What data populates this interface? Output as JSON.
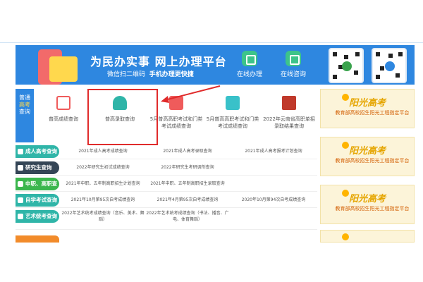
{
  "banner": {
    "title": "为民办实事  网上办理平台",
    "sub_prefix": "微信扫二维码",
    "sub_bold": "手机办理更快捷",
    "services": [
      {
        "label": "在线办理",
        "icon": "edit-icon"
      },
      {
        "label": "在线咨询",
        "icon": "chat-icon"
      }
    ],
    "qr_codes": [
      "qr-code-1",
      "qr-code-2"
    ]
  },
  "category": {
    "line1": "普通",
    "line2": "高考",
    "line3": "查询"
  },
  "tiles": [
    {
      "label": "普高成绩查询",
      "icon": "search-doc-icon",
      "color": "#ef5b5b"
    },
    {
      "label": "普高录取查询",
      "icon": "graduation-cap-icon",
      "color": "#2fb5a8"
    },
    {
      "label": "5月普高高职考试和门类考试成绩查询",
      "icon": "letter-a-icon",
      "color": "#ef5b5b"
    },
    {
      "label": "5月普高高职考试和门类考试成绩查询",
      "icon": "letter-a-icon",
      "color": "#39c1c9"
    },
    {
      "label": "2022年云南省高职单招录取结果查询",
      "icon": "building-icon",
      "color": "#c0392b"
    }
  ],
  "promo": {
    "title": "阳光高考",
    "subtitle": "教育部高校招生阳光工程指定平台",
    "count": 4
  },
  "rows": [
    {
      "label": "成人高考查询",
      "color": "#2fb5a8",
      "cells": [
        "2021年成人高考成绩查询",
        "2021年成人高考录取查询",
        "2021年成人高考报考计划查询"
      ]
    },
    {
      "label": "研究生查询",
      "color": "#344556",
      "cells": [
        "2022年研究生初试成绩查询",
        "2022年研究生考研调剂查询",
        ""
      ]
    },
    {
      "label": "中职、高职查询",
      "color": "#3bb64d",
      "cells": [
        "2021年中职、五年制高职招生计划查询",
        "2021年中职、五年制高职招生录取查询",
        ""
      ]
    },
    {
      "label": "自学考试查询",
      "color": "#2fb5a8",
      "cells": [
        "2021年10月第95次自考成绩查询",
        "2021年4月第95次自考成绩查询",
        "2020年10月第94次自考成绩查询"
      ]
    },
    {
      "label": "艺术统考查询",
      "color": "#2fb5a8",
      "cells": [
        "2022年艺术统考成绩查询（音乐、美术、舞蹈）",
        "2022年艺术统考成绩查询（书法、播音、广电、体育舞蹈）",
        ""
      ]
    }
  ]
}
